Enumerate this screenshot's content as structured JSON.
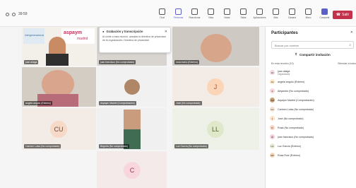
{
  "window": {
    "time": "39:59"
  },
  "toolbar": {
    "tools": [
      {
        "label": "Chat",
        "icon": "chat-icon"
      },
      {
        "label": "Personas",
        "icon": "people-icon",
        "active": true
      },
      {
        "label": "Reaccionar",
        "icon": "reaction-icon"
      },
      {
        "label": "Vista",
        "icon": "view-icon"
      },
      {
        "label": "Notas",
        "icon": "notes-icon"
      },
      {
        "label": "Salas",
        "icon": "rooms-icon"
      },
      {
        "label": "Aplicaciones",
        "icon": "apps-icon"
      },
      {
        "label": "Más",
        "icon": "more-icon"
      },
      {
        "label": "Cámara",
        "icon": "camera-icon"
      },
      {
        "label": "Micro",
        "icon": "mic-icon"
      },
      {
        "label": "Compartir",
        "icon": "share-icon",
        "badge": true
      }
    ],
    "leave_label": "Salir"
  },
  "popup": {
    "title": "Grabación y transcripción",
    "body": "Al unirte a esta reunión, aceptas la directiva de privacidad de la organización. Directiva de privacidad"
  },
  "tiles": [
    {
      "name": "juan aliaga",
      "logo_left": "Intergeneracional",
      "logo_brand": "aspaym",
      "logo_sub": "madrid"
    },
    {
      "name": "juan francisco (No comprobado)"
    },
    {
      "name": "rosa maría (Externo)"
    },
    {
      "name": "angela angulo (Externo)"
    },
    {
      "name": "Aspaym Madrid (Comprobación)"
    },
    {
      "name": "José (No comprobado)",
      "initials": "J"
    },
    {
      "name": "Carmen Luisa (No comprobado)",
      "initials": "CU"
    },
    {
      "name": "Begoña (No comprobado)"
    },
    {
      "name": "Luz García (No comprobado)",
      "initials": "LL"
    },
    {
      "initials": "C"
    }
  ],
  "panel": {
    "title": "Participantes",
    "search_placeholder": "Buscar por nombre",
    "share_label": "Compartir invitación",
    "section_label": "En esta reunión (10)",
    "mute_all": "Silenciar a todos",
    "people": [
      {
        "name": "juan aliaga",
        "role": "Organizador",
        "initials": "JA",
        "color": "#f3d6e5"
      },
      {
        "name": "angela angulo (Externo)",
        "role": "",
        "initials": "AA",
        "color": "#fde7c8"
      },
      {
        "name": "Alejandro (No comprobado)",
        "role": "",
        "initials": "A",
        "color": "#f8d7da"
      },
      {
        "name": "Aspaym Madrid (Comprobación)",
        "role": "",
        "initials": "AM",
        "color": "#c9a27a"
      },
      {
        "name": "Carmen Luisa (No comprobado)",
        "role": "",
        "initials": "CU",
        "color": "#f6e3d4"
      },
      {
        "name": "José (No comprobado)",
        "role": "",
        "initials": "J",
        "color": "#fde2c9"
      },
      {
        "name": "Rosa (No comprobado)",
        "role": "",
        "initials": "R",
        "color": "#fbd3c4"
      },
      {
        "name": "juan francisco (No comprobado)",
        "role": "",
        "initials": "JF",
        "color": "#f5d0d8"
      },
      {
        "name": "Luz García (Externo)",
        "role": "",
        "initials": "LG",
        "color": "#e3ecd2"
      },
      {
        "name": "Rosa Ruiz (Externo)",
        "role": "",
        "initials": "RR",
        "color": "#f3d8b8"
      }
    ]
  }
}
